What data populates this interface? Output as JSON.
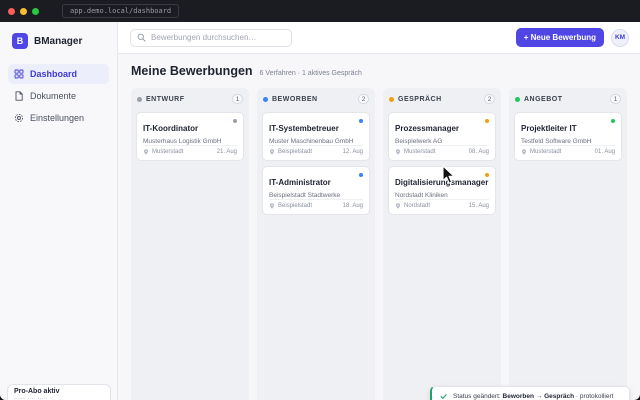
{
  "window": {
    "url": "app.demo.local/dashboard",
    "dots": [
      "#ff5f57",
      "#febc2e",
      "#28c840"
    ]
  },
  "sidebar": {
    "brand": {
      "letter": "B",
      "name": "BManager"
    },
    "items": [
      {
        "label": "Dashboard",
        "icon": "grid-icon",
        "active": true
      },
      {
        "label": "Dokumente",
        "icon": "document-icon",
        "active": false
      },
      {
        "label": "Einstellungen",
        "icon": "gear-icon",
        "active": false
      }
    ],
    "plan": {
      "title": "Pro-Abo aktiv",
      "subtitle": "······ ···· ·····"
    }
  },
  "topbar": {
    "search_placeholder": "Bewerbungen durchsuchen…",
    "new_button": "+ Neue Bewerbung",
    "avatar_initials": "KM"
  },
  "page": {
    "title": "Meine Bewerbungen",
    "meta": "6 Verfahren · 1 aktives Gespräch"
  },
  "board": {
    "columns": [
      {
        "title": "ENTWURF",
        "count": "1",
        "color": "#9ca0ab",
        "cards": [
          {
            "title": "IT-Koordinator",
            "company": "Musterhaus Logistik GmbH",
            "location": "Musterstadt",
            "date": "21. Aug",
            "dot": "#9ca0ab"
          }
        ]
      },
      {
        "title": "BEWORBEN",
        "count": "2",
        "color": "#3b82f6",
        "cards": [
          {
            "title": "IT-Systembetreuer",
            "company": "Muster Maschinenbau GmbH",
            "location": "Beispielstadt",
            "date": "12. Aug",
            "dot": "#3b82f6"
          },
          {
            "title": "IT-Administrator",
            "company": "Beispielstadt Stadtwerke",
            "location": "Beispielstadt",
            "date": "18. Aug",
            "dot": "#3b82f6"
          }
        ]
      },
      {
        "title": "GESPRÄCH",
        "count": "2",
        "color": "#f59e0b",
        "cards": [
          {
            "title": "Prozessmanager",
            "company": "Beispielwerk AG",
            "location": "Musterstadt",
            "date": "08. Aug",
            "dot": "#f59e0b"
          },
          {
            "title": "Digitalisierungsmanager",
            "company": "Nordstadt Kliniken",
            "location": "Nordstadt",
            "date": "15. Aug",
            "dot": "#f59e0b"
          }
        ]
      },
      {
        "title": "ANGEBOT",
        "count": "1",
        "color": "#22c55e",
        "cards": [
          {
            "title": "Projektleiter IT",
            "company": "Testfeld Software GmbH",
            "location": "Musterstadt",
            "date": "01. Aug",
            "dot": "#22c55e"
          }
        ]
      }
    ]
  },
  "toast": {
    "prefix": "Status geändert: ",
    "from": "Beworben",
    "arrow": " → ",
    "to": "Gespräch",
    "suffix": " · protokolliert"
  }
}
